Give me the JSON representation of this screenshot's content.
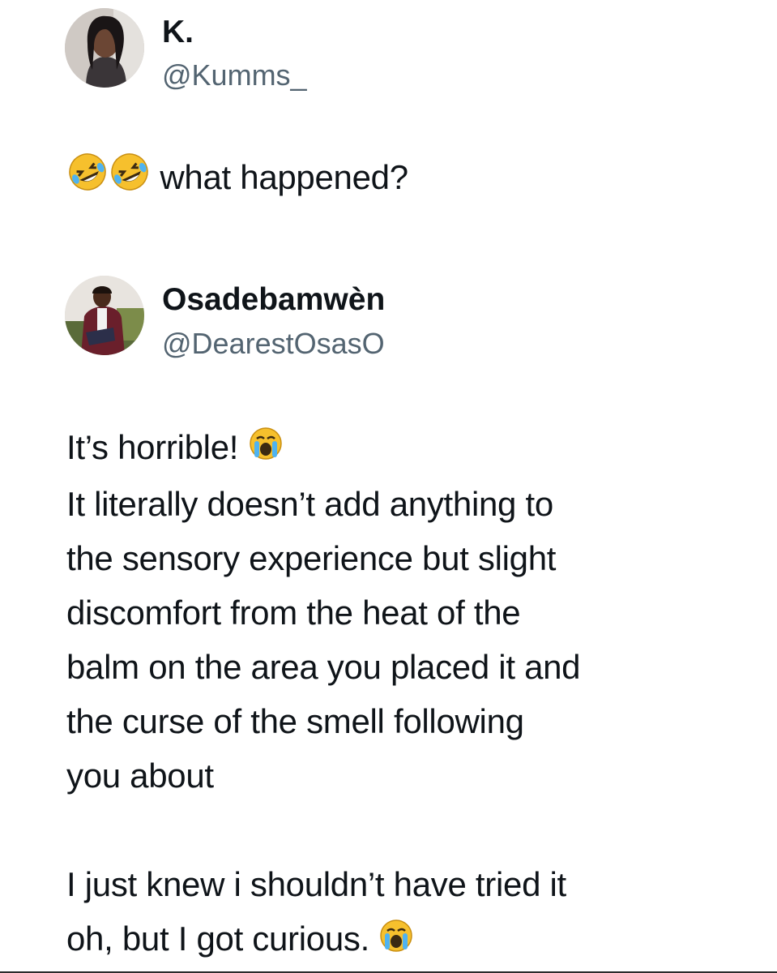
{
  "tweets": [
    {
      "name": "K.",
      "handle": "@Kumms_",
      "text": "what happened?",
      "emojis": [
        "rolling-on-floor-laughing-icon",
        "rolling-on-floor-laughing-icon"
      ]
    },
    {
      "name": "Osadebamwèn",
      "handle": "@DearestOsasO",
      "lines": [
        "It’s horrible!",
        "It literally doesn’t add anything to",
        "the sensory experience but slight",
        "discomfort from the heat of the",
        "balm on the area you placed it and",
        "the curse of the smell following",
        "you about",
        "I just knew i shouldn’t have tried it",
        "oh, but I got curious."
      ],
      "emojis": [
        "loudly-crying-face-icon"
      ]
    }
  ],
  "colors": {
    "text": "#0f1419",
    "handle": "#536471",
    "emoji": "#f6c02d"
  }
}
